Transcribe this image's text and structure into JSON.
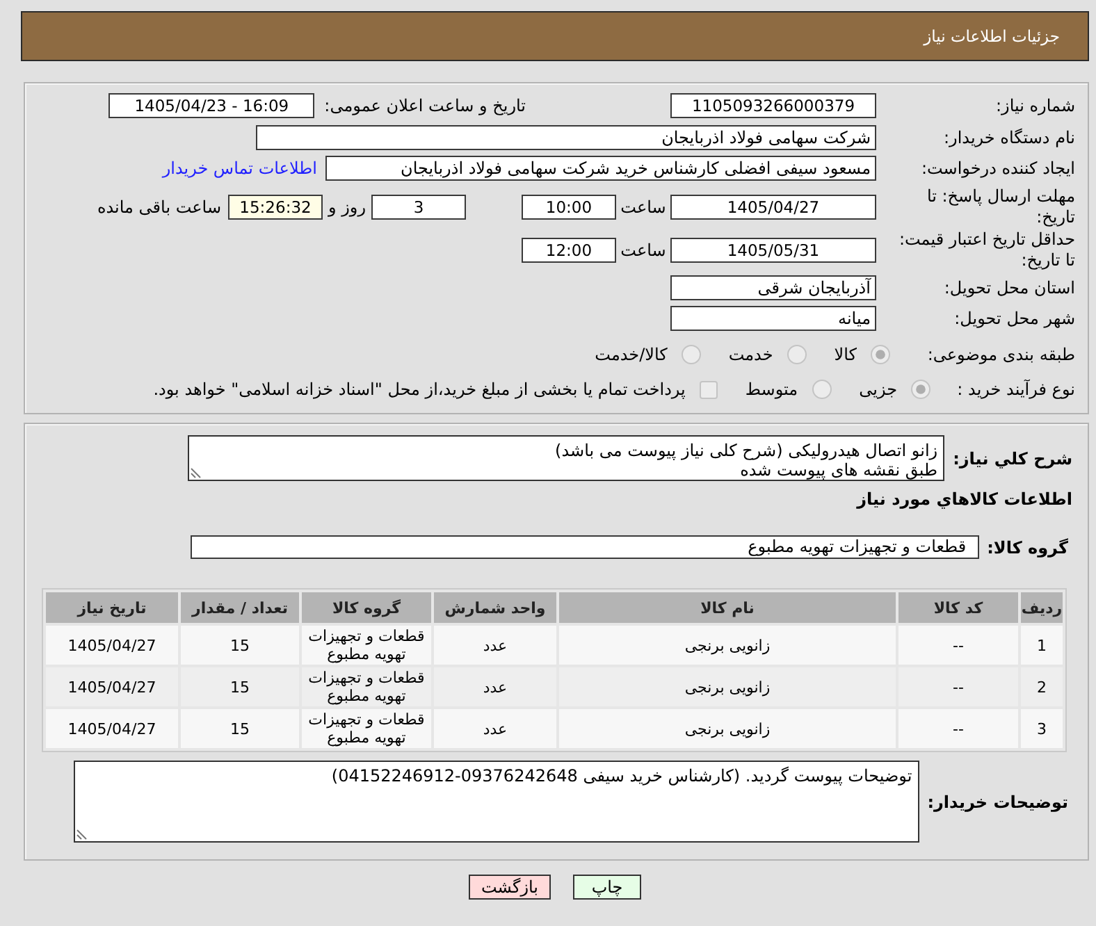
{
  "header": {
    "title": "جزئیات اطلاعات نیاز"
  },
  "details": {
    "need_number": {
      "label": "شماره نیاز:",
      "value": "1105093266000379"
    },
    "announce_datetime": {
      "label": "تاریخ و ساعت اعلان عمومی:",
      "value": "1405/04/23 - 16:09"
    },
    "buyer_org": {
      "label": "نام دستگاه خریدار:",
      "value": "شرکت سهامی فولاد اذربایجان"
    },
    "requester": {
      "label": "ایجاد کننده درخواست:",
      "value": "مسعود سیفی افضلی کارشناس خرید شرکت سهامی فولاد اذربایجان",
      "link": "اطلاعات تماس خریدار"
    },
    "reply_deadline": {
      "label": "مهلت ارسال پاسخ: تا تاریخ:",
      "date": "1405/04/27",
      "time_label": "ساعت",
      "time": "10:00",
      "days": "3",
      "days_label": "روز و",
      "remaining": "15:26:32",
      "remaining_label": "ساعت باقی مانده"
    },
    "price_validity": {
      "label": "حداقل تاریخ اعتبار قیمت: تا تاریخ:",
      "date": "1405/05/31",
      "time_label": "ساعت",
      "time": "12:00"
    },
    "province": {
      "label": "استان محل تحویل:",
      "value": "آذربایجان شرقی"
    },
    "city": {
      "label": "شهر محل تحویل:",
      "value": "میانه"
    },
    "category": {
      "label": "طبقه بندی موضوعی:",
      "options": [
        {
          "label": "کالا",
          "selected": true
        },
        {
          "label": "خدمت",
          "selected": false
        },
        {
          "label": "کالا/خدمت",
          "selected": false
        }
      ]
    },
    "purchase_process": {
      "label": "نوع فرآیند خرید :",
      "options": [
        {
          "label": "جزیی",
          "selected": true
        },
        {
          "label": "متوسط",
          "selected": false
        }
      ],
      "treasury": {
        "label": "پرداخت تمام یا بخشی از مبلغ خرید،از محل \"اسناد خزانه اسلامی\" خواهد بود.",
        "checked": false
      }
    }
  },
  "need": {
    "description": {
      "label": "شرح کلي نياز:",
      "value": "زانو اتصال هیدرولیکی (شرح کلی نیاز پیوست می باشد)\nطبق نقشه های پیوست شده"
    },
    "goods_title": "اطلاعات کالاهاي مورد نياز",
    "goods_group": {
      "label": "گروه کالا:",
      "value": "قطعات و تجهیزات تهویه مطبوع"
    },
    "table": {
      "columns": [
        "ردیف",
        "کد کالا",
        "نام کالا",
        "واحد شمارش",
        "گروه کالا",
        "تعداد / مقدار",
        "تاریخ نیاز"
      ],
      "rows": [
        {
          "cells": [
            "1",
            "--",
            "زانویی برنجی",
            "عدد",
            "قطعات و تجهیزات تهویه مطبوع",
            "15",
            "1405/04/27"
          ]
        },
        {
          "cells": [
            "2",
            "--",
            "زانویی برنجی",
            "عدد",
            "قطعات و تجهیزات تهویه مطبوع",
            "15",
            "1405/04/27"
          ]
        },
        {
          "cells": [
            "3",
            "--",
            "زانویی برنجی",
            "عدد",
            "قطعات و تجهیزات تهویه مطبوع",
            "15",
            "1405/04/27"
          ]
        }
      ]
    },
    "buyer_notes": {
      "label": "توضیحات خریدار:",
      "value": "توضیحات پیوست گردید. (کارشناس خرید سیفی 09376242648-04152246912)"
    }
  },
  "buttons": [
    {
      "label": "چاپ",
      "kind": "print"
    },
    {
      "label": "بازگشت",
      "kind": "back"
    }
  ]
}
